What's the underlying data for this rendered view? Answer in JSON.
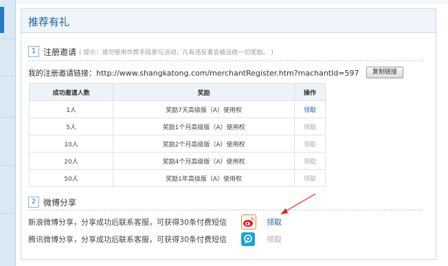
{
  "panel": {
    "title": "推荐有礼"
  },
  "register": {
    "num": "1",
    "title": "注册邀请",
    "hint": "( 提示：请勿使用作弊手段参与活动，凡有违反者会被没收一切奖励。 )",
    "link_text": "我的注册邀请链接：http://www.shangkatong.com/merchantRegister.htm?machantId=597",
    "copy_label": "复制链接",
    "table": {
      "headers": [
        "成功邀请人数",
        "奖励",
        "操作"
      ],
      "rows": [
        {
          "count": "1人",
          "reward": "奖励7天高级版（A）使用权",
          "action": "领取",
          "enabled": true
        },
        {
          "count": "5人",
          "reward": "奖励1个月高级版（A）使用权",
          "action": "领取",
          "enabled": false
        },
        {
          "count": "10人",
          "reward": "奖励2个月高级版（A）使用权",
          "action": "领取",
          "enabled": false
        },
        {
          "count": "20人",
          "reward": "奖励4个月高级版（A）使用权",
          "action": "领取",
          "enabled": false
        },
        {
          "count": "50人",
          "reward": "奖励1年高级版（A）使用权",
          "action": "领取",
          "enabled": false
        }
      ]
    }
  },
  "weibo": {
    "num": "2",
    "title": "微博分享",
    "rows": [
      {
        "text": "新浪微博分享，分享成功后联系客服，可获得30条付费短信",
        "icon": "sina-weibo-icon",
        "action": "领取",
        "enabled": true
      },
      {
        "text": "腾讯微博分享，分享成功后联系客服，可获得30条付费短信",
        "icon": "tencent-weibo-icon",
        "action": "领取",
        "enabled": false
      }
    ]
  },
  "colors": {
    "accent": "#2a5db0",
    "title": "#1f5f9c",
    "disabled": "#aaaaaa",
    "arrow": "#e0251b"
  }
}
